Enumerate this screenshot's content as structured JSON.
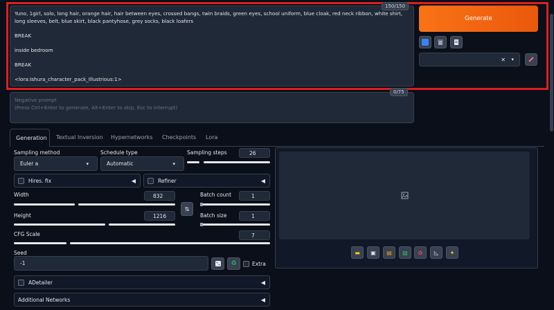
{
  "prompt": {
    "text": "Yuno, 1girl, solo, long hair, orange hair, hair between eyes, crossed bangs, twin braids, green eyes, school uniform, blue cloak, red neck ribbon, white shirt, long sleeves, belt, blue skirt, black pantyhose, grey socks, black loafers\n\nBREAK\n\ninside bedroom\n\nBREAK\n\n<lora:Ishura_character_pack_Illustrious:1>",
    "counter": "150/150"
  },
  "negative_prompt": {
    "placeholder": "Negative prompt\n(Press Ctrl+Enter to generate, Alt+Enter to skip, Esc to interrupt)",
    "counter": "0/75"
  },
  "generate_label": "Generate",
  "tabs": [
    "Generation",
    "Textual Inversion",
    "Hypernetworks",
    "Checkpoints",
    "Lora"
  ],
  "sampling": {
    "method_label": "Sampling method",
    "method_value": "Euler a",
    "schedule_label": "Schedule type",
    "schedule_value": "Automatic",
    "steps_label": "Sampling steps",
    "steps_value": "26"
  },
  "hires_label": "Hires. fix",
  "refiner_label": "Refiner",
  "width_label": "Width",
  "width_value": "832",
  "height_label": "Height",
  "height_value": "1216",
  "batch_count_label": "Batch count",
  "batch_count_value": "1",
  "batch_size_label": "Batch size",
  "batch_size_value": "1",
  "cfg_label": "CFG Scale",
  "cfg_value": "7",
  "seed_label": "Seed",
  "seed_value": "-1",
  "extra_label": "Extra",
  "adetailer_label": "ADetailer",
  "additional_networks_label": "Additional Networks",
  "colors": {
    "accent": "#f97316",
    "highlight": "#dc1f1f",
    "background": "#0b0f19",
    "panel": "#1f2937"
  }
}
